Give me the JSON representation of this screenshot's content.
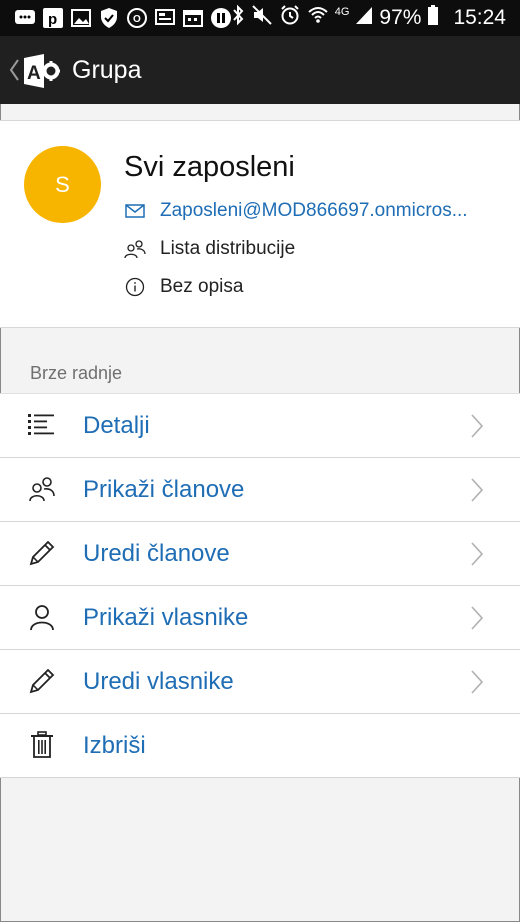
{
  "status_bar": {
    "battery_percent": "97%",
    "time": "15:24",
    "network": "4G",
    "left_icons": [
      "chat-icon",
      "parking-icon",
      "image-icon",
      "shield-icon",
      "outlook-icon",
      "cast-icon",
      "calendar-icon",
      "pause-icon"
    ],
    "right_icons": [
      "bluetooth-icon",
      "mute-icon",
      "alarm-icon",
      "wifi-icon",
      "signal-icon",
      "battery-icon"
    ]
  },
  "app_bar": {
    "title": "Grupa",
    "logo_letter": "A"
  },
  "group": {
    "avatar_letter": "S",
    "avatar_color": "#f7b500",
    "name": "Svi zaposleni",
    "email": "Zaposleni@MOD866697.onmicros...",
    "type": "Lista distribucije",
    "description": "Bez opisa"
  },
  "quick_actions": {
    "label": "Brze radnje",
    "items": [
      {
        "label": "Detalji",
        "icon": "list-icon",
        "has_chevron": true
      },
      {
        "label": "Prikaži članove",
        "icon": "people-icon",
        "has_chevron": true
      },
      {
        "label": "Uredi članove",
        "icon": "pencil-icon",
        "has_chevron": true
      },
      {
        "label": "Prikaži vlasnike",
        "icon": "person-icon",
        "has_chevron": true
      },
      {
        "label": "Uredi vlasnike",
        "icon": "pencil-icon",
        "has_chevron": true
      },
      {
        "label": "Izbriši",
        "icon": "trash-icon",
        "has_chevron": false
      }
    ]
  },
  "colors": {
    "link_blue": "#1e6db5",
    "header_bg": "#202020",
    "status_bg": "#0d0d0d",
    "page_bg": "#f3f3f3"
  }
}
